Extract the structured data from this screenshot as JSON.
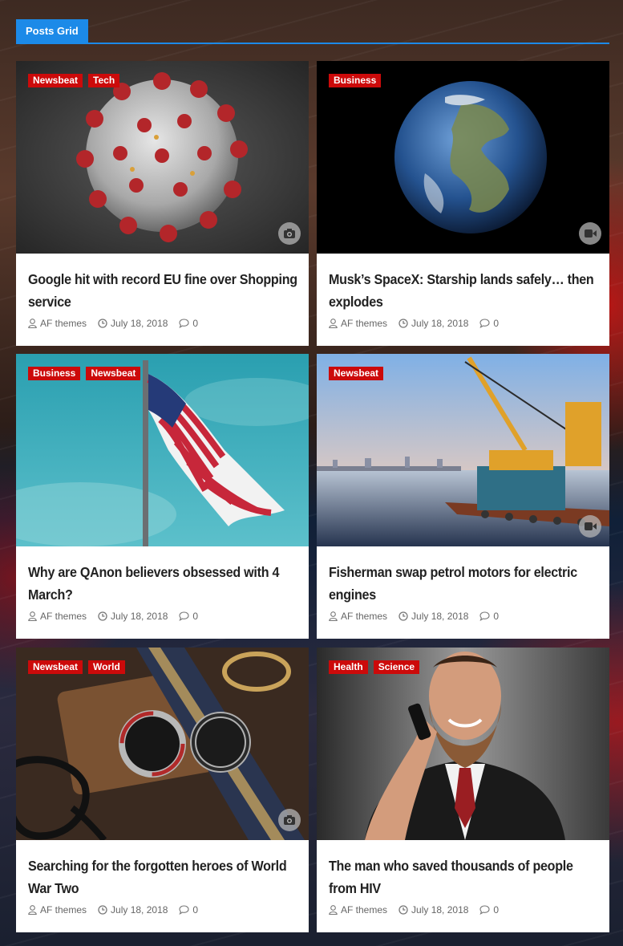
{
  "section": {
    "title": "Posts Grid"
  },
  "colors": {
    "accent": "#1c8ae8",
    "tag": "#cc0a0a"
  },
  "posts": [
    {
      "tags": [
        "Newsbeat",
        "Tech"
      ],
      "title": "Google hit with record EU fine over Shopping service",
      "author": "AF themes",
      "date": "July 18, 2018",
      "comments": "0",
      "format_icon": "camera-icon",
      "image": "coronavirus"
    },
    {
      "tags": [
        "Business"
      ],
      "title": "Musk’s SpaceX: Starship lands safely… then explodes",
      "author": "AF themes",
      "date": "July 18, 2018",
      "comments": "0",
      "format_icon": "video-icon",
      "image": "earth"
    },
    {
      "tags": [
        "Business",
        "Newsbeat"
      ],
      "title": "Why are QAnon believers obsessed with 4 March?",
      "author": "AF themes",
      "date": "July 18, 2018",
      "comments": "0",
      "format_icon": "",
      "image": "us-flag"
    },
    {
      "tags": [
        "Newsbeat"
      ],
      "title": "Fisherman swap petrol motors for electric engines",
      "author": "AF themes",
      "date": "July 18, 2018",
      "comments": "0",
      "format_icon": "video-icon",
      "image": "crane-barge"
    },
    {
      "tags": [
        "Newsbeat",
        "World"
      ],
      "title": "Searching for the forgotten heroes of World War Two",
      "author": "AF themes",
      "date": "July 18, 2018",
      "comments": "0",
      "format_icon": "camera-icon",
      "image": "watches"
    },
    {
      "tags": [
        "Health",
        "Science"
      ],
      "title": "The man who saved thousands of people from HIV",
      "author": "AF themes",
      "date": "July 18, 2018",
      "comments": "0",
      "format_icon": "",
      "image": "bearded-man"
    }
  ]
}
